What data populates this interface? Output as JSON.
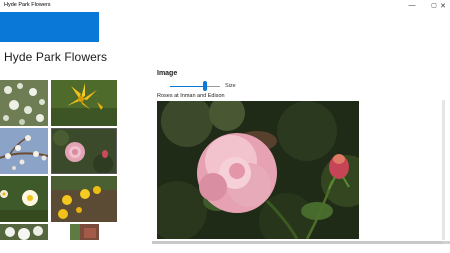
{
  "window": {
    "title": "Hyde Park Flowers",
    "minimize_glyph": "—",
    "maximize_glyph": "▢",
    "close_glyph": "✕"
  },
  "page": {
    "title": "Hyde Park Flowers"
  },
  "sidebar": {
    "section_title": "Image",
    "size_label": "Size",
    "size_value_fraction": 0.68,
    "caption": "Roses at Inman and Edison"
  },
  "gallery": {
    "selected_index": 3,
    "items": [
      {
        "icon": "white-flowers-thumbnail"
      },
      {
        "icon": "yellow-lily-thumbnail"
      },
      {
        "icon": "blossom-branch-thumbnail"
      },
      {
        "icon": "pink-rose-thumbnail"
      },
      {
        "icon": "white-yellow-flowers-thumbnail"
      },
      {
        "icon": "yellow-flowers-thumbnail"
      },
      {
        "icon": "white-bloom-thumbnail"
      },
      {
        "icon": "garden-thumbnail"
      }
    ]
  },
  "colors": {
    "accent": "#0a78d7",
    "selection_border": "#5b5b5b"
  }
}
